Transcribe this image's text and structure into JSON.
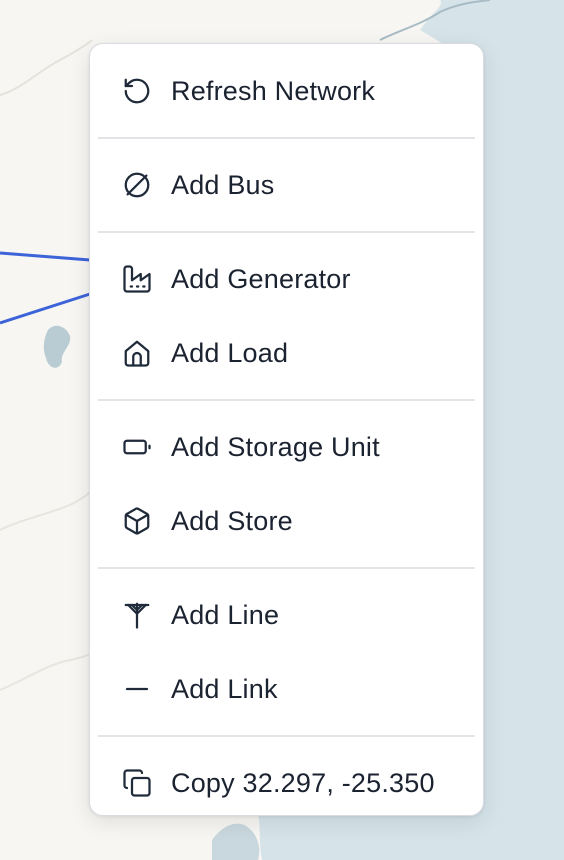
{
  "context_menu": {
    "items": [
      {
        "label": "Refresh Network",
        "icon": "refresh-icon"
      },
      {
        "label": "Add Bus",
        "icon": "bus-icon"
      },
      {
        "label": "Add Generator",
        "icon": "factory-icon"
      },
      {
        "label": "Add Load",
        "icon": "house-icon"
      },
      {
        "label": "Add Storage Unit",
        "icon": "battery-icon"
      },
      {
        "label": "Add Store",
        "icon": "box-icon"
      },
      {
        "label": "Add Line",
        "icon": "pylon-icon"
      },
      {
        "label": "Add Link",
        "icon": "minus-icon"
      },
      {
        "label": "Copy 32.297, -25.350",
        "icon": "copy-icon"
      }
    ]
  },
  "map": {
    "land_color": "#f7f6f2",
    "water_color": "#d6e4ea",
    "line_color": "#3d63d9"
  }
}
